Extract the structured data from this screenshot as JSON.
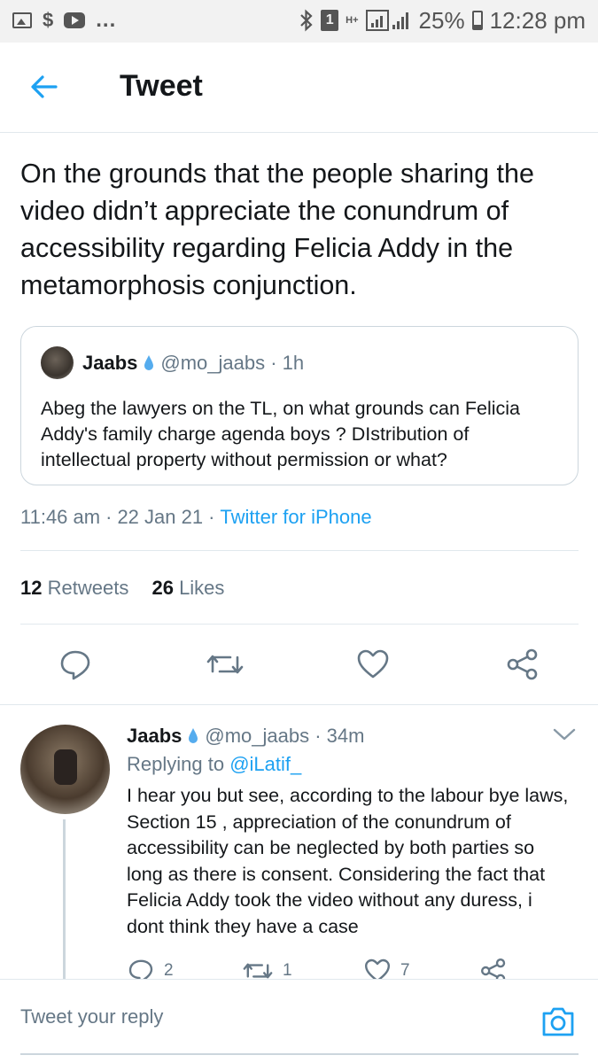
{
  "status_bar": {
    "battery": "25%",
    "time": "12:28 pm",
    "sim_slot": "1",
    "network": "H+",
    "more": "..."
  },
  "header": {
    "title": "Tweet"
  },
  "tweet": {
    "text": "On the grounds that the people sharing the video didn’t appreciate the conundrum of accessibility regarding Felicia Addy in the metamorphosis conjunction.",
    "quoted": {
      "name": "Jaabs",
      "handle": "@mo_jaabs · 1h",
      "text": "Abeg the lawyers on the TL, on what grounds can Felicia Addy's family charge agenda boys ? DIstribution of intellectual property without permission or what?"
    },
    "time": "11:46 am",
    "date": "22 Jan 21",
    "source": "Twitter for iPhone",
    "retweets_count": "12",
    "retweets_label": "Retweets",
    "likes_count": "26",
    "likes_label": "Likes"
  },
  "reply": {
    "name": "Jaabs",
    "handle": "@mo_jaabs · 34m",
    "replying_to_label": "Replying to",
    "replying_to_handle": "@iLatif_",
    "text": "I hear you but see, according to the labour bye laws, Section 15 , appreciation of  the conundrum of accessibility can be neglected by both parties so long as there is consent. Considering the fact that Felicia Addy took the video without any duress, i dont think they have a case",
    "reply_count": "2",
    "retweet_count": "1",
    "like_count": "7"
  },
  "compose": {
    "placeholder": "Tweet your reply"
  },
  "colors": {
    "accent": "#1da1f2",
    "secondary_text": "#657786",
    "icon": "#657786",
    "drop_badge": "#55acee"
  }
}
